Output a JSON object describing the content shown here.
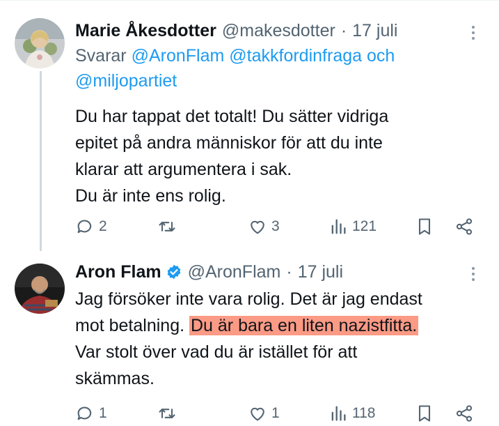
{
  "tweets": [
    {
      "name": "Marie Åkesdotter",
      "handle": "@makesdotter",
      "date": "17 juli",
      "verified": false,
      "reply_prefix": "Svarar",
      "reply_mentions": "@AronFlam @takkfordinfraga och",
      "reply_mentions_2": "@miljopartiet",
      "lines": [
        "Du har tappat det totalt! Du sätter vidriga",
        "epitet på andra människor för att du inte",
        "klarar att argumentera i sak.",
        "Du är inte ens rolig."
      ],
      "stats": {
        "replies": "2",
        "retweets": "",
        "likes": "3",
        "views": "121"
      }
    },
    {
      "name": "Aron Flam",
      "handle": "@AronFlam",
      "date": "17 juli",
      "verified": true,
      "line1": "Jag försöker inte vara rolig. Det är jag endast",
      "line2_plain": "mot betalning.",
      "line2_highlight": "Du är bara en liten nazistfitta.",
      "line3": "Var stolt över vad du är istället för att",
      "line4": "skämmas.",
      "highlight_color": "#fb9a85",
      "stats": {
        "replies": "1",
        "retweets": "",
        "likes": "1",
        "views": "118"
      }
    }
  ],
  "colors": {
    "text": "#0f1419",
    "secondary": "#536471",
    "link": "#1d9bf0",
    "verified": "#1d9bf0",
    "thread_line": "#cfd9de"
  },
  "icons": [
    "reply-icon",
    "retweet-icon",
    "like-icon",
    "views-icon",
    "bookmark-icon",
    "share-icon",
    "more-icon",
    "verified-badge-icon"
  ]
}
